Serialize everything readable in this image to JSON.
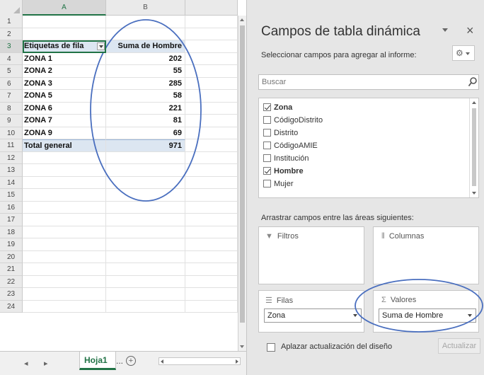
{
  "sheet": {
    "columns": [
      "A",
      "B"
    ],
    "row_numbers": [
      "1",
      "2",
      "3",
      "4",
      "5",
      "6",
      "7",
      "8",
      "9",
      "10",
      "11",
      "12",
      "13",
      "14",
      "15",
      "16",
      "17",
      "18",
      "19",
      "20",
      "21",
      "22",
      "23",
      "24"
    ],
    "pivot_header": {
      "label": "Etiquetas de fila",
      "value": "Suma de Hombre"
    },
    "rows": [
      {
        "label": "ZONA 1",
        "value": "202"
      },
      {
        "label": "ZONA 2",
        "value": "55"
      },
      {
        "label": "ZONA 3",
        "value": "285"
      },
      {
        "label": "ZONA 5",
        "value": "58"
      },
      {
        "label": "ZONA 6",
        "value": "221"
      },
      {
        "label": "ZONA 7",
        "value": "81"
      },
      {
        "label": "ZONA 9",
        "value": "69"
      }
    ],
    "total": {
      "label": "Total general",
      "value": "971"
    },
    "tabs": {
      "active": "Hoja1",
      "more": "...",
      "add": "+"
    }
  },
  "panel": {
    "title": "Campos de tabla dinámica",
    "subtitle": "Seleccionar campos para agregar al informe:",
    "close": "×",
    "search_placeholder": "Buscar",
    "fields": [
      {
        "label": "Zona",
        "checked": true
      },
      {
        "label": "CódigoDistrito",
        "checked": false
      },
      {
        "label": "Distrito",
        "checked": false
      },
      {
        "label": "CódigoAMIE",
        "checked": false
      },
      {
        "label": "Institución",
        "checked": false
      },
      {
        "label": "Hombre",
        "checked": true
      },
      {
        "label": "Mujer",
        "checked": false
      }
    ],
    "areas_label": "Arrastrar campos entre las áreas siguientes:",
    "areas": {
      "filters": {
        "label": "Filtros",
        "icon": "filter-icon"
      },
      "columns": {
        "label": "Columnas",
        "icon": "columns-icon"
      },
      "rows": {
        "label": "Filas",
        "icon": "rows-icon",
        "item": "Zona"
      },
      "values": {
        "label": "Valores",
        "icon": "sigma-icon",
        "item": "Suma de Hombre"
      }
    },
    "defer_label": "Aplazar actualización del diseño",
    "update_label": "Actualizar"
  },
  "colors": {
    "excel_green": "#217346",
    "pivot_header_fill": "#dce6f1",
    "annotation_blue": "#4a6fbf"
  }
}
